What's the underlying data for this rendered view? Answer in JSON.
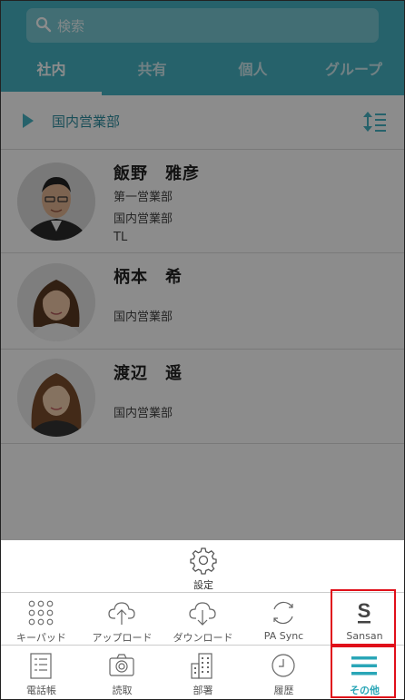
{
  "search": {
    "placeholder": "検索"
  },
  "tabs": [
    {
      "label": "社内",
      "active": true
    },
    {
      "label": "共有",
      "active": false
    },
    {
      "label": "個人",
      "active": false
    },
    {
      "label": "グループ",
      "active": false
    }
  ],
  "department": {
    "name": "国内営業部"
  },
  "contacts": [
    {
      "name": "飯野　雅彦",
      "lines": [
        "第一営業部",
        "国内営業部",
        "TL"
      ]
    },
    {
      "name": "柄本　希",
      "lines": [
        "国内営業部"
      ]
    },
    {
      "name": "渡辺　遥",
      "lines": [
        "国内営業部"
      ]
    }
  ],
  "menu": {
    "settings_label": "設定",
    "row1": [
      {
        "label": "キーパッド",
        "icon": "keypad-icon"
      },
      {
        "label": "アップロード",
        "icon": "cloud-upload-icon"
      },
      {
        "label": "ダウンロード",
        "icon": "cloud-download-icon"
      },
      {
        "label": "PA Sync",
        "icon": "sync-icon"
      },
      {
        "label": "Sansan",
        "icon": "sansan-logo-icon"
      }
    ],
    "row2": [
      {
        "label": "電話帳",
        "icon": "phonebook-icon"
      },
      {
        "label": "読取",
        "icon": "camera-icon"
      },
      {
        "label": "部署",
        "icon": "building-icon"
      },
      {
        "label": "履歴",
        "icon": "clock-icon"
      },
      {
        "label": "その他",
        "icon": "menu-icon",
        "selected": true
      }
    ]
  },
  "colors": {
    "accent": "#45b3c3",
    "highlight": "#e0101a"
  }
}
